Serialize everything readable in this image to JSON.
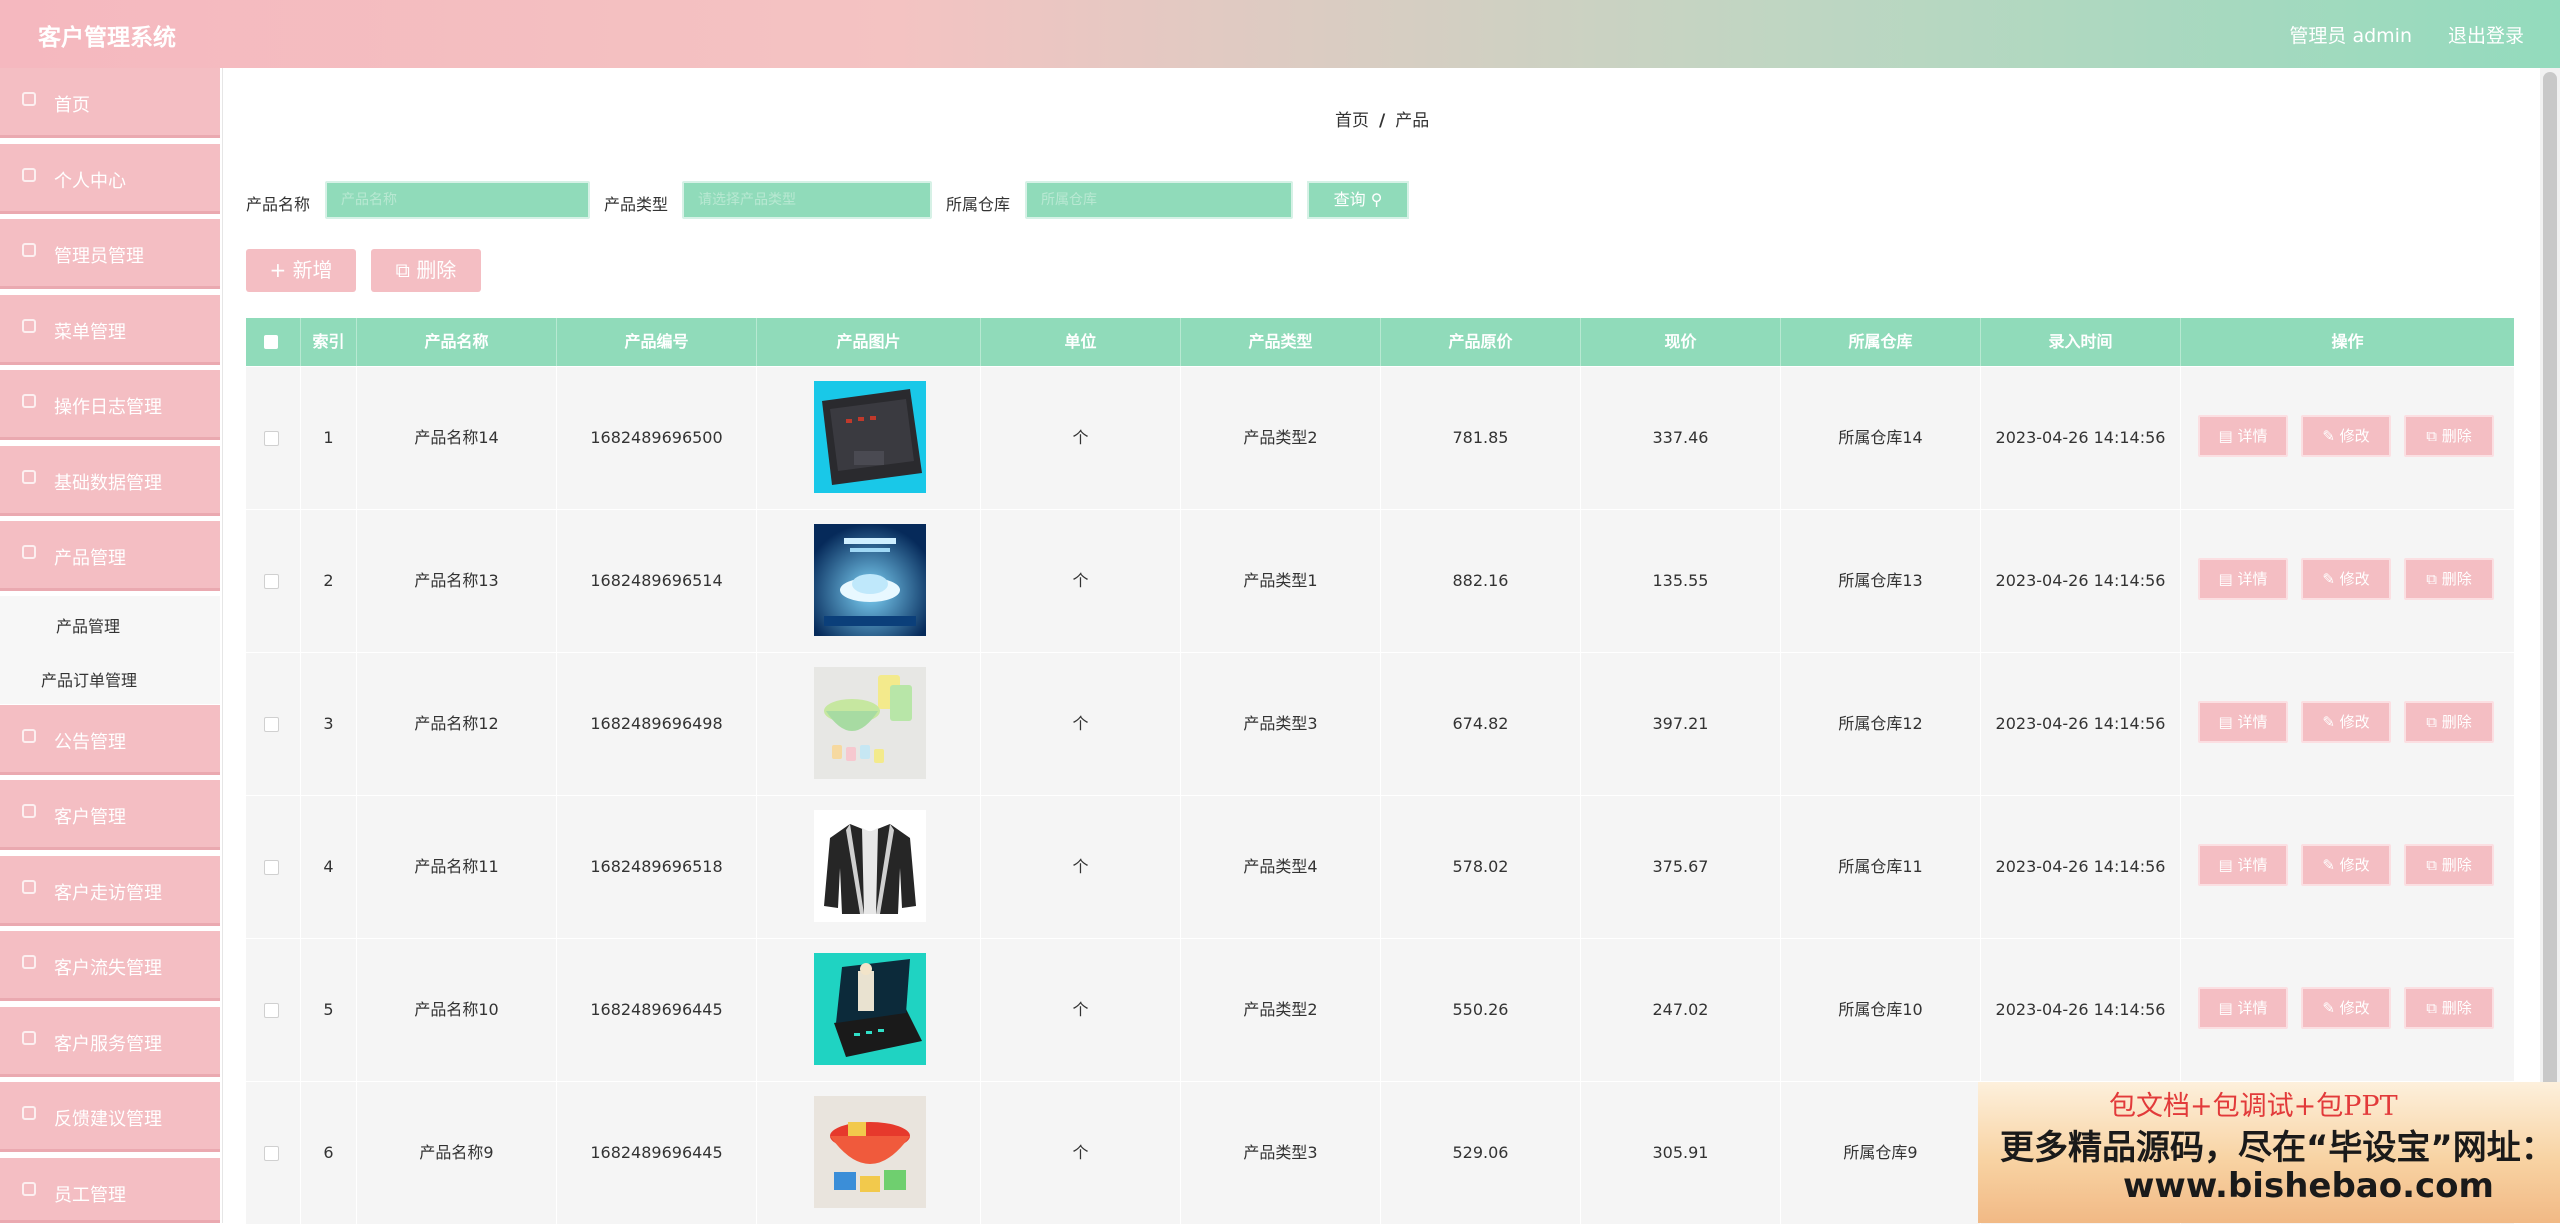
{
  "header": {
    "title": "客户管理系统",
    "user": "管理员 admin",
    "logout": "退出登录"
  },
  "sidebar": {
    "items": [
      {
        "label": "首页"
      },
      {
        "label": "个人中心"
      },
      {
        "label": "管理员管理"
      },
      {
        "label": "菜单管理"
      },
      {
        "label": "操作日志管理"
      },
      {
        "label": "基础数据管理"
      },
      {
        "label": "产品管理"
      },
      {
        "label": "公告管理"
      },
      {
        "label": "客户管理"
      },
      {
        "label": "客户走访管理"
      },
      {
        "label": "客户流失管理"
      },
      {
        "label": "客户服务管理"
      },
      {
        "label": "反馈建议管理"
      },
      {
        "label": "员工管理"
      }
    ],
    "sub_items": [
      {
        "label": "产品管理"
      },
      {
        "label": "产品订单管理"
      }
    ]
  },
  "breadcrumb": {
    "home": "首页",
    "sep": "/",
    "current": "产品"
  },
  "search": {
    "name_label": "产品名称",
    "name_placeholder": "产品名称",
    "type_label": "产品类型",
    "type_placeholder": "请选择产品类型",
    "warehouse_label": "所属仓库",
    "warehouse_placeholder": "所属仓库",
    "query_button": "查询"
  },
  "toolbar": {
    "add_label": "新增",
    "delete_label": "删除"
  },
  "table": {
    "columns": [
      "索引",
      "产品名称",
      "产品编号",
      "产品图片",
      "单位",
      "产品类型",
      "产品原价",
      "现价",
      "所属仓库",
      "录入时间",
      "操作"
    ],
    "rows": [
      {
        "index": "1",
        "name": "产品名称14",
        "code": "1682489696500",
        "unit": "个",
        "type": "产品类型2",
        "price": "781.85",
        "current": "337.46",
        "warehouse": "所属仓库14",
        "time": "2023-04-26 14:14:56",
        "img": "laptop"
      },
      {
        "index": "2",
        "name": "产品名称13",
        "code": "1682489696514",
        "unit": "个",
        "type": "产品类型1",
        "price": "882.16",
        "current": "135.55",
        "warehouse": "所属仓库13",
        "time": "2023-04-26 14:14:56",
        "img": "poster"
      },
      {
        "index": "3",
        "name": "产品名称12",
        "code": "1682489696498",
        "unit": "个",
        "type": "产品类型3",
        "price": "674.82",
        "current": "397.21",
        "warehouse": "所属仓库12",
        "time": "2023-04-26 14:14:56",
        "img": "cups"
      },
      {
        "index": "4",
        "name": "产品名称11",
        "code": "1682489696518",
        "unit": "个",
        "type": "产品类型4",
        "price": "578.02",
        "current": "375.67",
        "warehouse": "所属仓库11",
        "time": "2023-04-26 14:14:56",
        "img": "jacket"
      },
      {
        "index": "5",
        "name": "产品名称10",
        "code": "1682489696445",
        "unit": "个",
        "type": "产品类型2",
        "price": "550.26",
        "current": "247.02",
        "warehouse": "所属仓库10",
        "time": "2023-04-26 14:14:56",
        "img": "gaming"
      },
      {
        "index": "6",
        "name": "产品名称9",
        "code": "1682489696445",
        "unit": "个",
        "type": "产品类型3",
        "price": "529.06",
        "current": "305.91",
        "warehouse": "所属仓库9",
        "time": "",
        "img": "toys"
      }
    ],
    "ops": {
      "detail": "详情",
      "edit": "修改",
      "delete": "删除"
    }
  },
  "watermark": {
    "line1": "包文档+包调试+包PPT",
    "line2": "更多精品源码，尽在“毕设宝”网址：",
    "line3": "www.bishebao.com"
  },
  "colors": {
    "pink": "#f4bec3",
    "mint": "#90dbba"
  }
}
